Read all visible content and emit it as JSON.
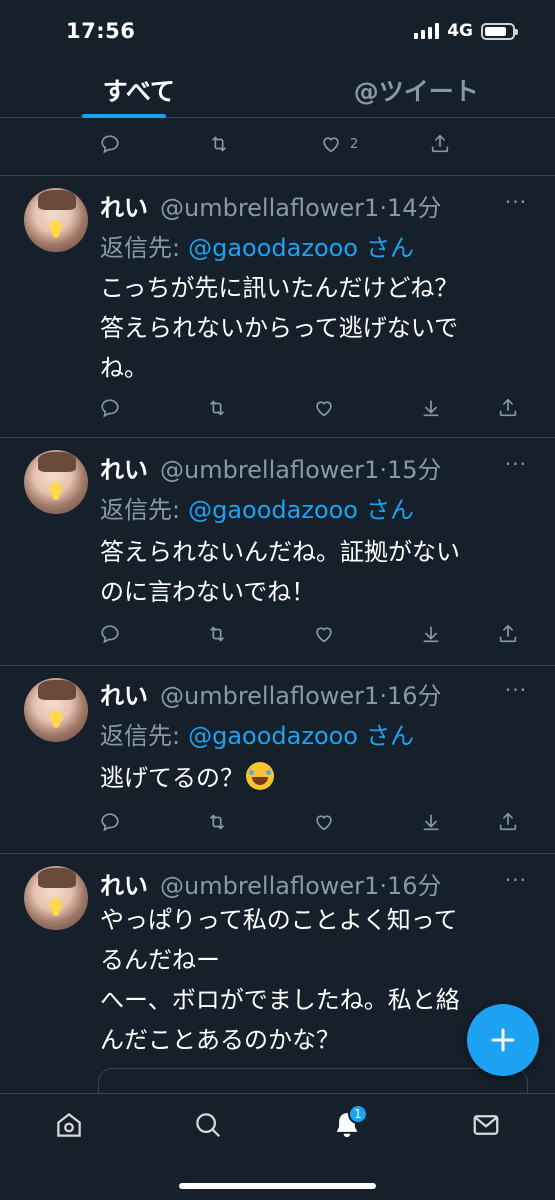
{
  "status_bar": {
    "time": "17:56",
    "network": "4G"
  },
  "tabs": [
    {
      "label": "すべて",
      "active": true
    },
    {
      "label": "@ツイート",
      "active": false
    }
  ],
  "top_actions": {
    "like_count": "2"
  },
  "tweets": [
    {
      "name": "れい",
      "handle": "@umbrellaflower1",
      "time": "·14分",
      "reply_prefix": "返信先:",
      "reply_user": "@gaoodazooo",
      "reply_suffix": "さん",
      "text": "こっちが先に訊いたんだけどね？\n答えられないからって逃げないで\nね。"
    },
    {
      "name": "れい",
      "handle": "@umbrellaflower1",
      "time": "·15分",
      "reply_prefix": "返信先:",
      "reply_user": "@gaoodazooo",
      "reply_suffix": "さん",
      "text": "答えられないんだね。証拠がない\nのに言わないでね！"
    },
    {
      "name": "れい",
      "handle": "@umbrellaflower1",
      "time": "·16分",
      "reply_prefix": "返信先:",
      "reply_user": "@gaoodazooo",
      "reply_suffix": "さん",
      "text": "逃げてるの？"
    },
    {
      "name": "れい",
      "handle": "@umbrellaflower1",
      "time": "·16分",
      "text": "やっぱりって私のことよく知って\nるんだねー\nへー、ボロがでましたね。私と絡\nんだことあるのかな？"
    }
  ],
  "more_label": "···",
  "nav": {
    "notification_badge": "1"
  },
  "colors": {
    "background": "#15202b",
    "accent": "#1da1f2",
    "muted": "#8899a6",
    "divider": "#38444d"
  },
  "icons": [
    "reply-icon",
    "retweet-icon",
    "like-icon",
    "download-icon",
    "share-icon",
    "compose-icon",
    "home-icon",
    "search-icon",
    "bell-icon",
    "mail-icon"
  ]
}
